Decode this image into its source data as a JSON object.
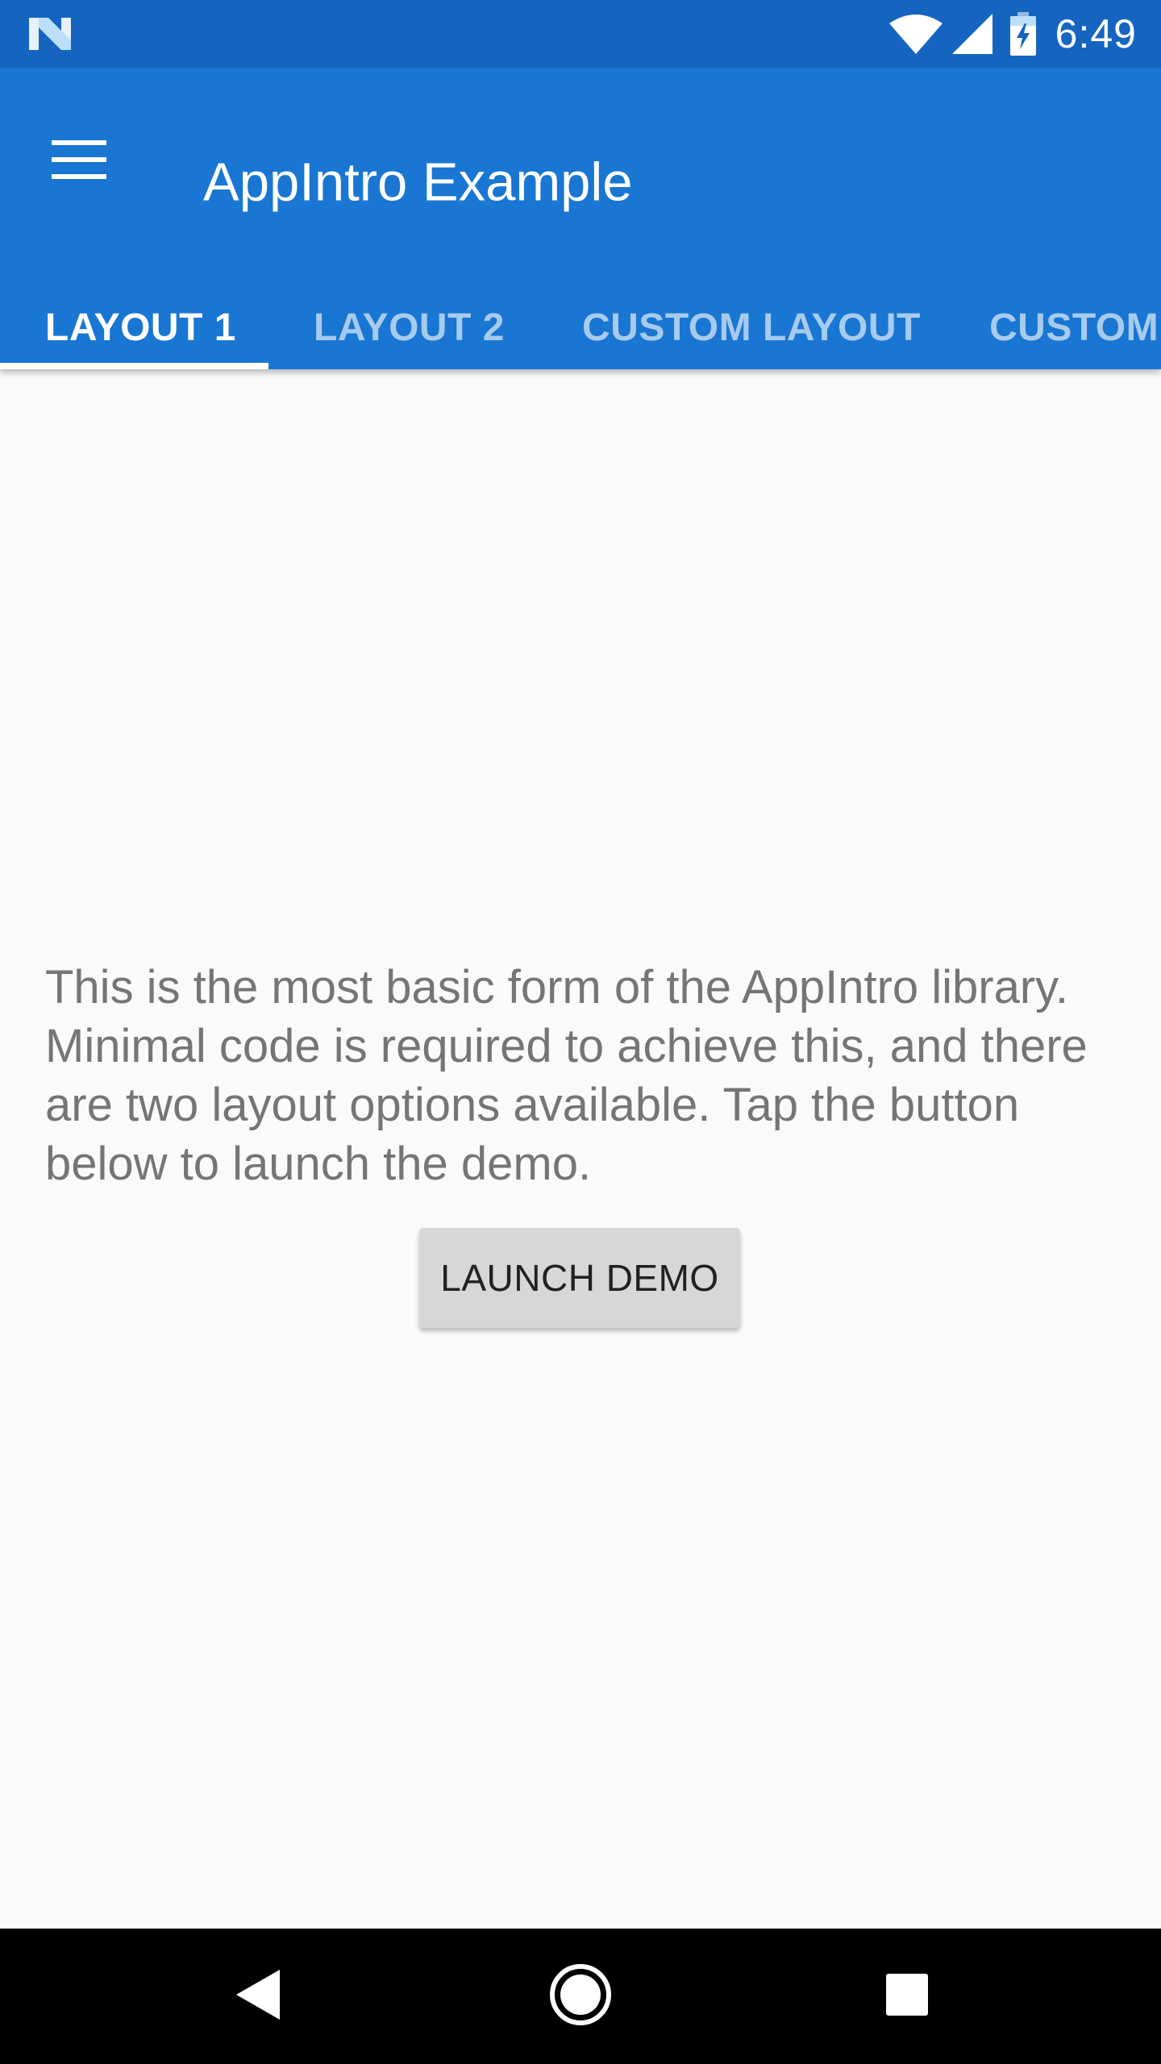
{
  "status_bar": {
    "time": "6:49",
    "left_icon": "android-n-logo-icon",
    "icons": [
      "wifi-icon",
      "signal-icon",
      "battery-charging-icon"
    ]
  },
  "app_bar": {
    "title": "AppIntro Example",
    "menu_icon": "menu-icon",
    "color": "#1976d2",
    "status_color": "#1565c0"
  },
  "tabs": [
    {
      "label": "LAYOUT 1",
      "active": true
    },
    {
      "label": "LAYOUT 2",
      "active": false
    },
    {
      "label": "CUSTOM LAYOUT",
      "active": false
    },
    {
      "label": "CUSTOM",
      "active": false
    }
  ],
  "main": {
    "description": "This is the most basic form of the AppIntro library. Minimal code is required to achieve this, and there are two layout options available. Tap the button below to launch the demo.",
    "button_label": "LAUNCH DEMO"
  },
  "nav_bar": {
    "icons": [
      "back-icon",
      "home-icon",
      "recents-icon"
    ]
  }
}
